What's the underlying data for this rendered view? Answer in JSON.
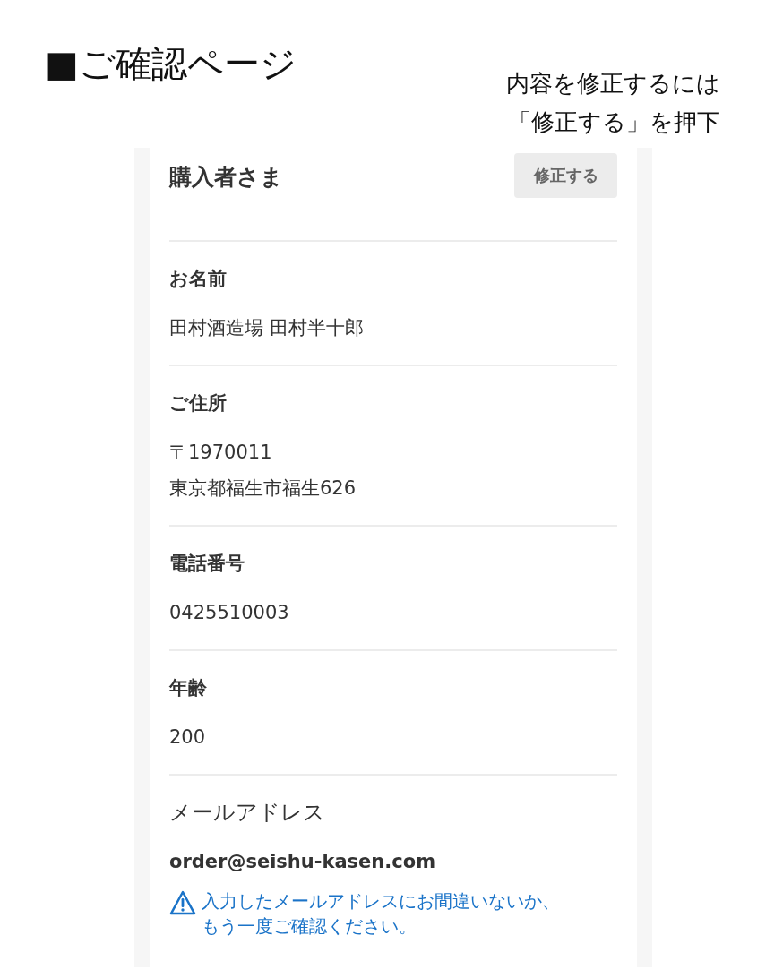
{
  "page_title": "■ご確認ページ",
  "note": [
    "内容を修正するには",
    "「修正する」を押下"
  ],
  "card": {
    "title": "購入者さま",
    "edit_button": "修正する",
    "fields": [
      {
        "kind": "plain",
        "label": "お名前",
        "lines": [
          "田村酒造場 田村半十郎"
        ]
      },
      {
        "kind": "plain",
        "label": "ご住所",
        "lines": [
          "〒1970011",
          "東京都福生市福生626"
        ]
      },
      {
        "kind": "plain",
        "label": "電話番号",
        "lines": [
          "0425510003"
        ]
      },
      {
        "kind": "plain",
        "label": "年齢",
        "lines": [
          "200"
        ]
      },
      {
        "kind": "email",
        "label": "メールアドレス",
        "lines": [
          "order@seishu-kasen.com"
        ],
        "notice": [
          "入力したメールアドレスにお間違いないか、",
          "もう一度ご確認ください。"
        ]
      }
    ]
  }
}
